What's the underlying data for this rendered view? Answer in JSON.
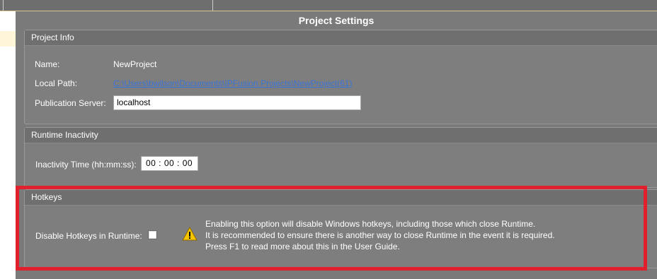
{
  "window": {
    "title": "Project Settings"
  },
  "project_info": {
    "header": "Project Info",
    "name_label": "Name:",
    "name_value": "NewProject",
    "path_label": "Local Path:",
    "path_value": "C:\\Users\\bwilson\\Documents\\IPFusion Projects\\NewProject(61)",
    "server_label": "Publication Server:",
    "server_value": "localhost"
  },
  "runtime_inactivity": {
    "header": "Runtime Inactivity",
    "time_label": "Inactivity Time (hh:mm:ss):",
    "time_value": "00 : 00 : 00"
  },
  "hotkeys": {
    "header": "Hotkeys",
    "disable_label": "Disable Hotkeys in Runtime:",
    "disable_checked": false,
    "warning_icon": "warning-icon",
    "warning_lines": [
      "Enabling this option will disable Windows hotkeys, including those which close Runtime.",
      "It is recommended to ensure there is another way to close Runtime in the event it is required.",
      "Press F1 to read more about this in the User Guide."
    ]
  },
  "colors": {
    "background": "#7a7a7a",
    "link": "#3b74d8",
    "highlight_frame": "#e0202c",
    "warning_fill": "#f5c400"
  }
}
